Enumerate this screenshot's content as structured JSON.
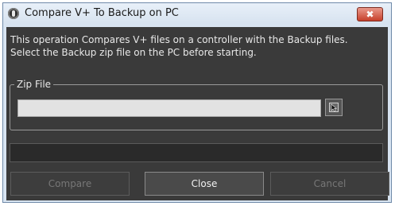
{
  "window": {
    "title": "Compare V+ To Backup on PC",
    "close_glyph": "✖"
  },
  "description": {
    "line1": "This operation Compares V+ files on a controller with the Backup files.",
    "line2": "Select the Backup zip file on the PC before starting."
  },
  "zip_file": {
    "group_label": "Zip File",
    "value": "",
    "placeholder": ""
  },
  "progress": {
    "fraction": 0
  },
  "buttons": {
    "compare_label": "Compare",
    "close_label": "Close",
    "cancel_label": "Cancel"
  },
  "icons": {
    "app": "app-logo-icon",
    "browse": "browse-cursor-icon"
  },
  "colors": {
    "client_background": "#3a3a3a",
    "close_button": "#c7402b"
  }
}
